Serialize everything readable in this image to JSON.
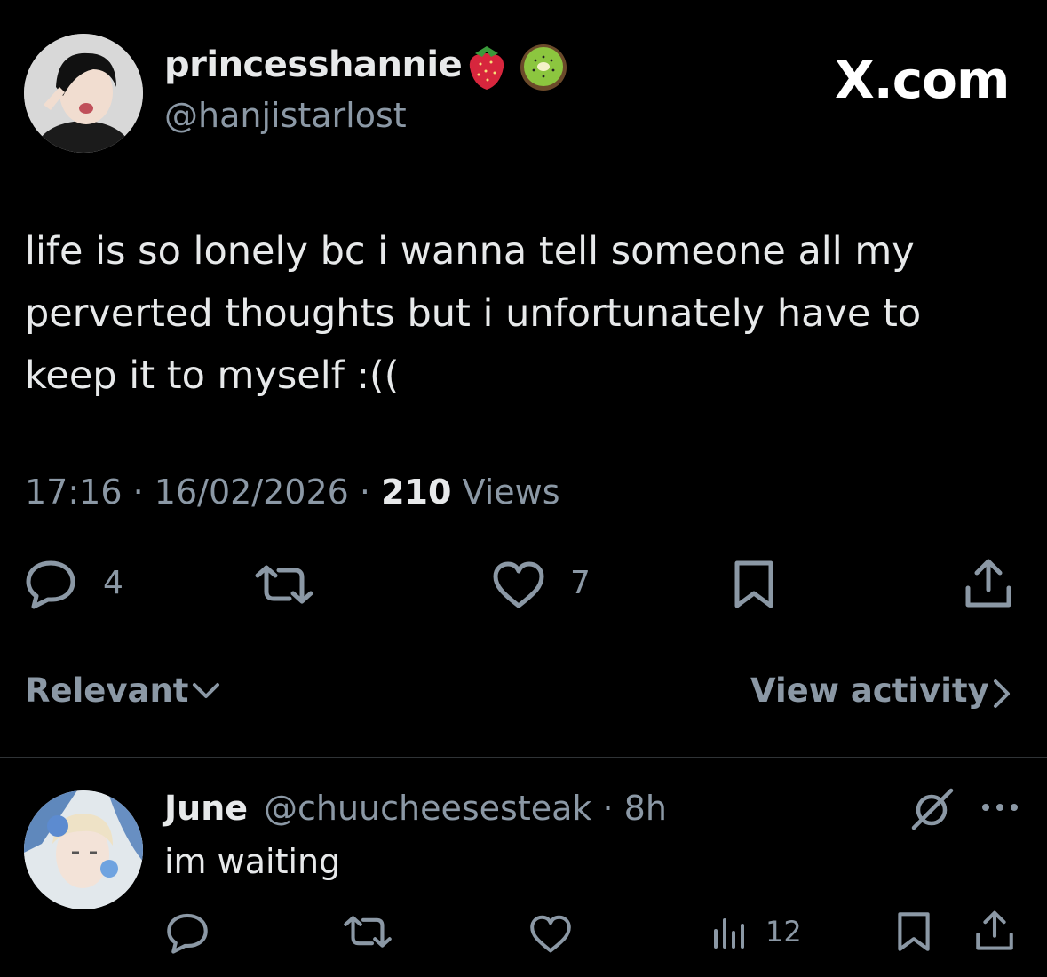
{
  "header": {
    "display_name": "princesshannie",
    "handle": "@hanjistarlost",
    "name_emojis": [
      "strawberry-emoji",
      "kiwi-emoji"
    ],
    "brand": "X.com"
  },
  "tweet": {
    "text": "life is so lonely bc i wanna tell someone all my\nperverted thoughts but i unfortunately have to\nkeep it to myself :((",
    "time": "17:16",
    "separator": "·",
    "date": "16/02/2026",
    "views_count": "210",
    "views_label": "Views"
  },
  "actions": {
    "reply_count": "4",
    "like_count": "7"
  },
  "sort_bar": {
    "relevant_label": "Relevant",
    "view_activity_label": "View activity"
  },
  "reply": {
    "name": "June",
    "handle_time": "@chuucheesesteak · 8h",
    "text": "im waiting",
    "views_count": "12"
  },
  "colors": {
    "background": "#000000",
    "primary_text": "#e7e9ea",
    "secondary_text": "#8b98a5",
    "divider": "#2f3336"
  }
}
